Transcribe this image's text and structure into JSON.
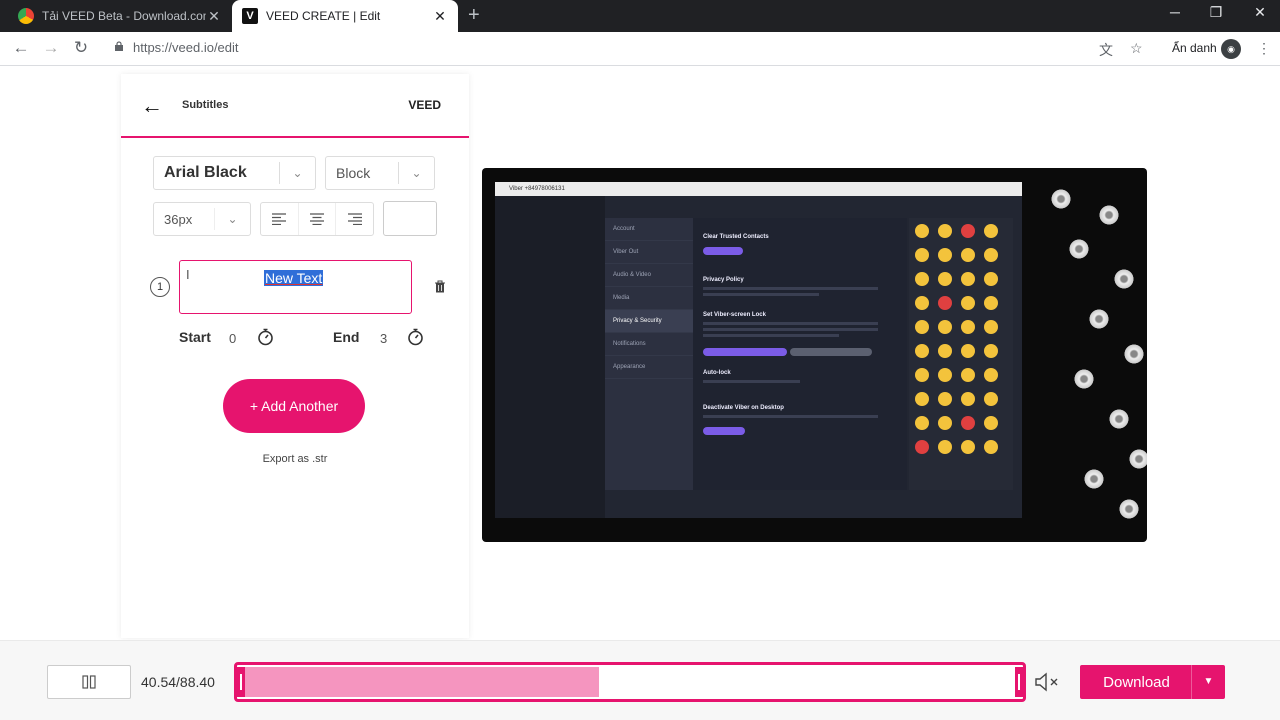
{
  "browser": {
    "tabs": [
      {
        "title": "Tải VEED Beta - Download.com.vn",
        "active": false
      },
      {
        "title": "VEED CREATE | Edit",
        "active": true
      }
    ],
    "url": "https://veed.io/edit",
    "profile_label": "Ẩn danh",
    "window_controls": [
      "minimize",
      "restore",
      "close"
    ]
  },
  "panel": {
    "back_icon": "arrow-left-icon",
    "breadcrumb": "Subtitles",
    "brand": "VEED",
    "font_family": "Arial Black",
    "style": "Block",
    "font_size": "36px",
    "alignment_options": [
      "left",
      "center",
      "right"
    ],
    "subtitle": {
      "index": "1",
      "text": "New Text",
      "start_label": "Start",
      "start_value": "0",
      "end_label": "End",
      "end_value": "3"
    },
    "add_button": "+ Add Another",
    "export_link": "Export as .str"
  },
  "video": {
    "title_bar": "Viber +84978006131",
    "menu": [
      "Account",
      "Viber Out",
      "Audio & Video",
      "Media",
      "Privacy & Security",
      "Notifications",
      "Appearance"
    ],
    "selected_menu": "Privacy & Security",
    "sections": [
      "Clear Trusted Contacts",
      "Privacy Policy",
      "Set Viber-screen Lock",
      "Auto-lock",
      "Deactivate Viber on Desktop"
    ]
  },
  "player": {
    "time": "40.54/88.40",
    "progress": 0.46,
    "download_label": "Download"
  },
  "colors": {
    "accent": "#e6146e",
    "progress_fill": "#f595bf",
    "selection": "#2f6ed8"
  }
}
